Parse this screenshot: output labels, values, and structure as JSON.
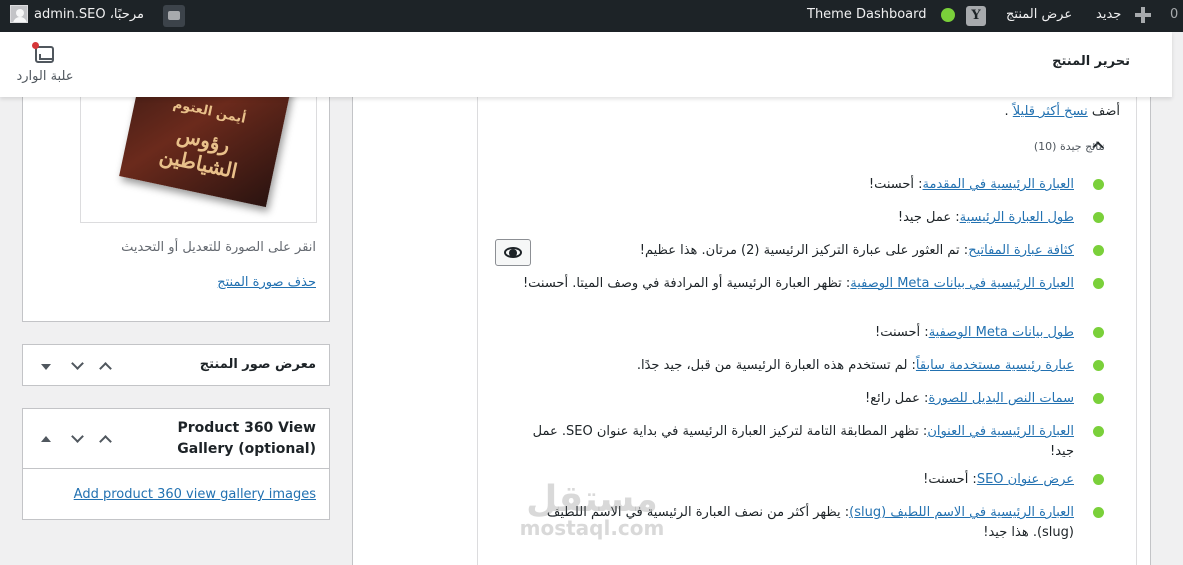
{
  "admin_bar": {
    "new_label": "جديد",
    "view_product": "عرض المنتج",
    "theme_dashboard": "Theme Dashboard",
    "count": "0",
    "greeting": "مرحبًا، admin.SEO"
  },
  "header": {
    "page_title": "تحرير المنتج",
    "inbox_label": "علبة الوارد"
  },
  "product_image": {
    "book_line1": "أيمن العتوم",
    "book_line2": "رؤوس الشياطين",
    "hint": "انقر على الصورة للتعديل أو التحديث",
    "remove_link": "حذف صورة المنتج"
  },
  "gallery_box": {
    "title": "معرض صور المنتج"
  },
  "box_360": {
    "title": "Product 360 View Gallery (optional)",
    "link": "Add product 360 view gallery images"
  },
  "seo": {
    "add_copy_prefix": "أضف",
    "add_copy_link": "نسخ أكثر قليلاً",
    "add_copy_suffix": ".",
    "good_results_header": "نتائج جيدة (10)",
    "results": [
      {
        "link": "العبارة الرئيسية في المقدمة",
        "text": ": أحسنت!"
      },
      {
        "link": "طول العبارة الرئيسية",
        "text": ": عمل جيد!"
      },
      {
        "link": "كثافة عبارة المفاتيح",
        "text": ": تم العثور على عبارة التركيز الرئيسية (2) مرتان. هذا عظيم!"
      },
      {
        "link": "العبارة الرئيسية في بيانات Meta الوصفية",
        "text": ": تظهر العبارة الرئيسية أو المرادفة في وصف الميتا. أحسنت!"
      },
      {
        "link": "طول بيانات Meta الوصفية",
        "text": ": أحسنت!"
      },
      {
        "link": "عبارة رئيسية مستخدمة سابقاً",
        "text": ": لم تستخدم هذه العبارة الرئيسية من قبل، جيد جدًا."
      },
      {
        "link": "سمات النص البديل للصورة",
        "text": ": عمل رائع!"
      },
      {
        "link": "العبارة الرئيسية في العنوان",
        "text": ": تظهر المطابقة التامة لتركيز العبارة الرئيسية في بداية عنوان SEO. عمل جيد!"
      },
      {
        "link": "عرض عنوان SEO",
        "text": ": أحسنت!"
      },
      {
        "link": "العبارة الرئيسية في الاسم اللطيف (slug)",
        "text": ": يظهر أكثر من نصف العبارة الرئيسية في الاسم اللطيف (slug). هذا جيد!"
      }
    ]
  },
  "watermark": {
    "arabic": "مستقل",
    "latin": "mostaql.com"
  },
  "colors": {
    "good": "#7ad03a",
    "link": "#2271b1",
    "adminbar": "#1d2327"
  },
  "icons": [
    "plus-icon",
    "yoast-icon",
    "status-dot-icon",
    "comment-icon",
    "avatar-icon",
    "inbox-icon",
    "eye-icon",
    "chevron-up-icon",
    "chevron-down-icon"
  ]
}
